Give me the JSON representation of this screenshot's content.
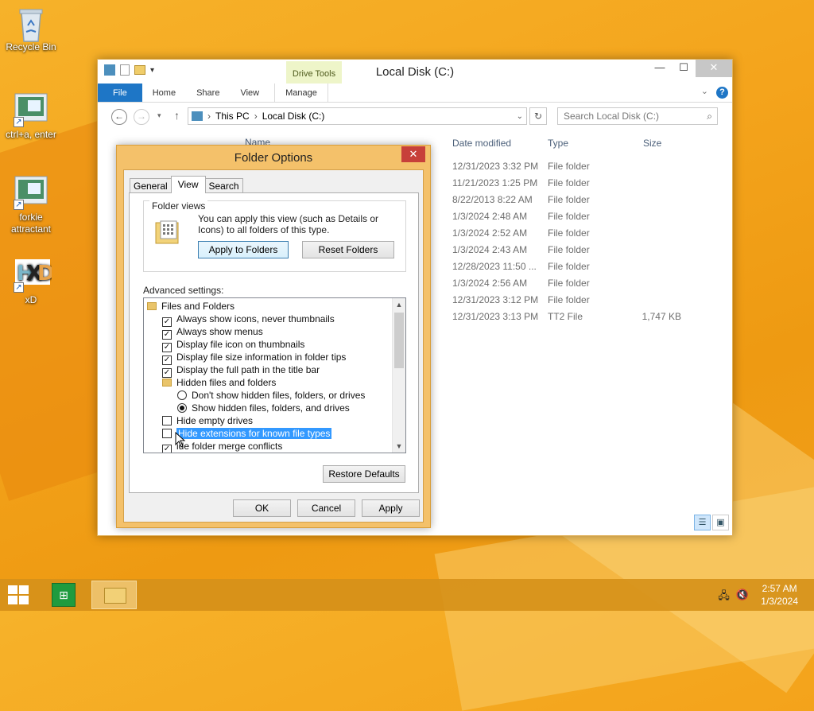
{
  "desktop": {
    "icons": [
      {
        "label": "Recycle Bin"
      },
      {
        "label": "ctrl+a, enter"
      },
      {
        "label": "forkie attractant"
      },
      {
        "label": "xD"
      }
    ]
  },
  "explorer": {
    "title": "Local Disk (C:)",
    "contextual_tab_group": "Drive Tools",
    "tabs": [
      "File",
      "Home",
      "Share",
      "View",
      "Manage"
    ],
    "breadcrumb": [
      "This PC",
      "Local Disk (C:)"
    ],
    "search_placeholder": "Search Local Disk (C:)",
    "columns": {
      "name": "Name",
      "date": "Date modified",
      "type": "Type",
      "size": "Size"
    },
    "rows": [
      {
        "date": "12/31/2023 3:32 PM",
        "type": "File folder",
        "size": ""
      },
      {
        "date": "11/21/2023 1:25 PM",
        "type": "File folder",
        "size": ""
      },
      {
        "date": "8/22/2013 8:22 AM",
        "type": "File folder",
        "size": ""
      },
      {
        "date": "1/3/2024 2:48 AM",
        "type": "File folder",
        "size": ""
      },
      {
        "date": "1/3/2024 2:52 AM",
        "type": "File folder",
        "size": ""
      },
      {
        "date": "1/3/2024 2:43 AM",
        "type": "File folder",
        "size": ""
      },
      {
        "date": "12/28/2023 11:50 ...",
        "type": "File folder",
        "size": ""
      },
      {
        "date": "1/3/2024 2:56 AM",
        "type": "File folder",
        "size": ""
      },
      {
        "date": "12/31/2023 3:12 PM",
        "type": "File folder",
        "size": ""
      },
      {
        "date": "12/31/2023 3:13 PM",
        "type": "TT2 File",
        "size": "1,747 KB"
      }
    ]
  },
  "dialog": {
    "title": "Folder Options",
    "close": "✕",
    "tabs": [
      "General",
      "View",
      "Search"
    ],
    "active_tab": "View",
    "folder_views": {
      "label": "Folder views",
      "text": "You can apply this view (such as Details or Icons) to all folders of this type.",
      "apply_button": "Apply to Folders",
      "reset_button": "Reset Folders"
    },
    "advanced_label": "Advanced settings:",
    "settings": [
      {
        "kind": "folder",
        "label": "Files and Folders"
      },
      {
        "kind": "check",
        "checked": true,
        "label": "Always show icons, never thumbnails"
      },
      {
        "kind": "check",
        "checked": true,
        "label": "Always show menus"
      },
      {
        "kind": "check",
        "checked": true,
        "label": "Display file icon on thumbnails"
      },
      {
        "kind": "check",
        "checked": true,
        "label": "Display file size information in folder tips"
      },
      {
        "kind": "check",
        "checked": true,
        "label": "Display the full path in the title bar"
      },
      {
        "kind": "folder",
        "label": "Hidden files and folders"
      },
      {
        "kind": "radio",
        "checked": false,
        "label": "Don't show hidden files, folders, or drives"
      },
      {
        "kind": "radio",
        "checked": true,
        "label": "Show hidden files, folders, and drives"
      },
      {
        "kind": "check",
        "checked": false,
        "label": "Hide empty drives"
      },
      {
        "kind": "check",
        "checked": false,
        "label": "Hide extensions for known file types",
        "selected": true
      },
      {
        "kind": "check",
        "checked": true,
        "label": "ide folder merge conflicts"
      }
    ],
    "restore_button": "Restore Defaults",
    "ok_button": "OK",
    "cancel_button": "Cancel",
    "apply_button": "Apply"
  },
  "taskbar": {
    "time": "2:57 AM",
    "date": "1/3/2024"
  }
}
